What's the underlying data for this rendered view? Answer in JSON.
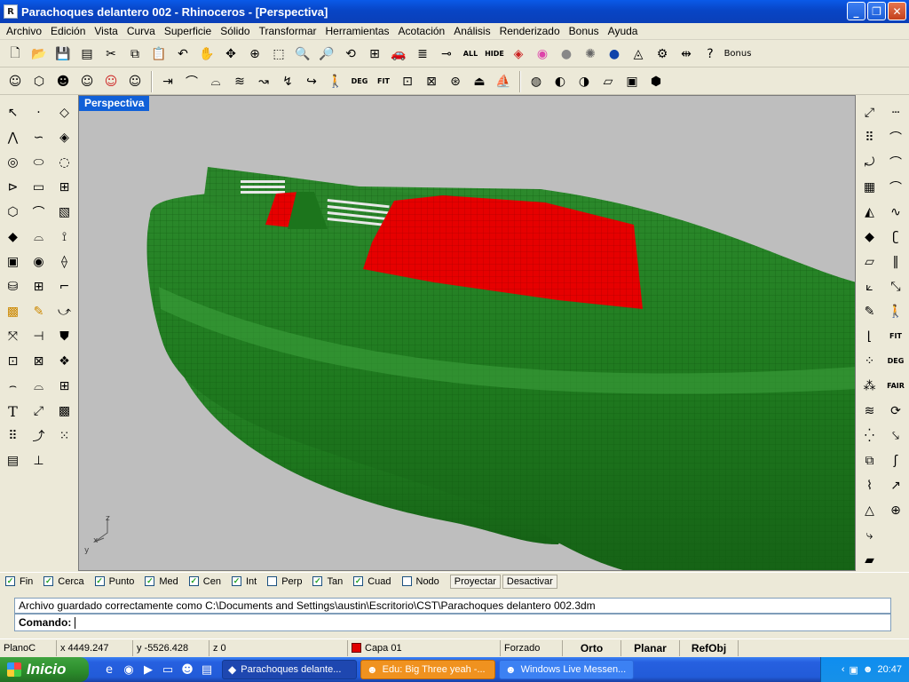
{
  "window": {
    "title": "Parachoques delantero 002 - Rhinoceros - [Perspectiva]",
    "buttons": [
      "_",
      "❐",
      "✕"
    ]
  },
  "menu": [
    "Archivo",
    "Edición",
    "Vista",
    "Curva",
    "Superficie",
    "Sólido",
    "Transformar",
    "Herramientas",
    "Acotación",
    "Análisis",
    "Renderizado",
    "Bonus",
    "Ayuda"
  ],
  "toolbar1": {
    "all_label": "ALL",
    "hide_label": "HIDE",
    "bonus_label": "Bonus"
  },
  "toolbar2": {
    "deg_label": "DEG",
    "fit_label": "FIT"
  },
  "right_toolbar": {
    "fit_label": "FIT",
    "deg_label": "DEG",
    "fair_label": "FAIR"
  },
  "viewport": {
    "label": "Perspectiva",
    "axes": {
      "x": "x",
      "y": "y",
      "z": "z"
    },
    "colors": {
      "background": "#bebebe",
      "body": "#1f7a1f",
      "accent": "#e60000"
    }
  },
  "osnaps": [
    {
      "label": "Fin",
      "checked": true
    },
    {
      "label": "Cerca",
      "checked": true
    },
    {
      "label": "Punto",
      "checked": true
    },
    {
      "label": "Med",
      "checked": true
    },
    {
      "label": "Cen",
      "checked": true
    },
    {
      "label": "Int",
      "checked": true
    },
    {
      "label": "Perp",
      "checked": false
    },
    {
      "label": "Tan",
      "checked": true
    },
    {
      "label": "Cuad",
      "checked": true
    },
    {
      "label": "Nodo",
      "checked": false
    }
  ],
  "osnap_buttons": {
    "project": "Proyectar",
    "disable": "Desactivar"
  },
  "command": {
    "history": "Archivo guardado correctamente como C:\\Documents and Settings\\austin\\Escritorio\\CST\\Parachoques delantero 002.3dm",
    "prompt": "Comando:"
  },
  "status": {
    "cplane": "PlanoC",
    "x": "x 4449.247",
    "y": "y -5526.428",
    "z": "z 0",
    "layer": "Capa 01",
    "layer_color": "#e00000",
    "forced": "Forzado",
    "ortho": "Orto",
    "planar": "Planar",
    "osnap": "RefObj"
  },
  "taskbar": {
    "start": "Inicio",
    "tasks": [
      {
        "label": "Parachoques delante...",
        "state": "active"
      },
      {
        "label": "Edu: Big Three yeah -...",
        "state": "flash"
      },
      {
        "label": "Windows Live Messen...",
        "state": "normal"
      }
    ],
    "clock": "20:47"
  }
}
